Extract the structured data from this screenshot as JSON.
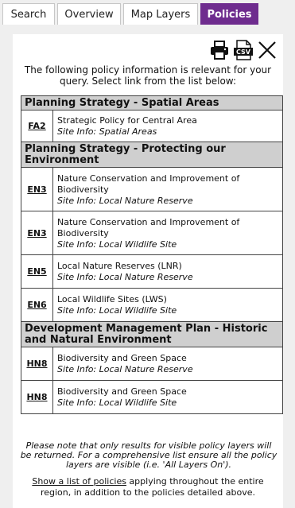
{
  "tabs": [
    {
      "label": "Search"
    },
    {
      "label": "Overview"
    },
    {
      "label": "Map Layers"
    },
    {
      "label": "Policies"
    }
  ],
  "icons": {
    "print": "printer-icon",
    "csv": "csv-icon",
    "close": "close-icon",
    "csv_text": "CSV"
  },
  "intro": "The following policy information is relevant for your query. Select link from the list below:",
  "groups": [
    {
      "heading": "Planning Strategy - Spatial Areas",
      "rows": [
        {
          "code": "FA2",
          "title": "Strategic Policy for Central Area",
          "site": "Site Info: Spatial Areas"
        }
      ]
    },
    {
      "heading": "Planning Strategy - Protecting our Environment",
      "rows": [
        {
          "code": "EN3",
          "title": "Nature Conservation and Improvement of Biodiversity",
          "site": "Site Info: Local Nature Reserve"
        },
        {
          "code": "EN3",
          "title": "Nature Conservation and Improvement of Biodiversity",
          "site": "Site Info: Local Wildlife Site"
        },
        {
          "code": "EN5",
          "title": "Local Nature Reserves (LNR)",
          "site": "Site Info: Local Nature Reserve"
        },
        {
          "code": "EN6",
          "title": "Local Wildlife Sites (LWS)",
          "site": "Site Info: Local Wildlife Site"
        }
      ]
    },
    {
      "heading": "Development Management Plan - Historic and Natural Environment",
      "rows": [
        {
          "code": "HN8",
          "title": "Biodiversity and Green Space",
          "site": "Site Info: Local Nature Reserve"
        },
        {
          "code": "HN8",
          "title": "Biodiversity and Green Space",
          "site": "Site Info: Local Wildlife Site"
        }
      ]
    }
  ],
  "note": "Please note that only results for visible policy layers will be returned. For a comprehensive list ensure all the policy layers are visible (i.e. 'All Layers On').",
  "show_list": {
    "link": "Show a list of policies",
    "rest": " applying throughout the entire region, in addition to the policies detailed above."
  }
}
